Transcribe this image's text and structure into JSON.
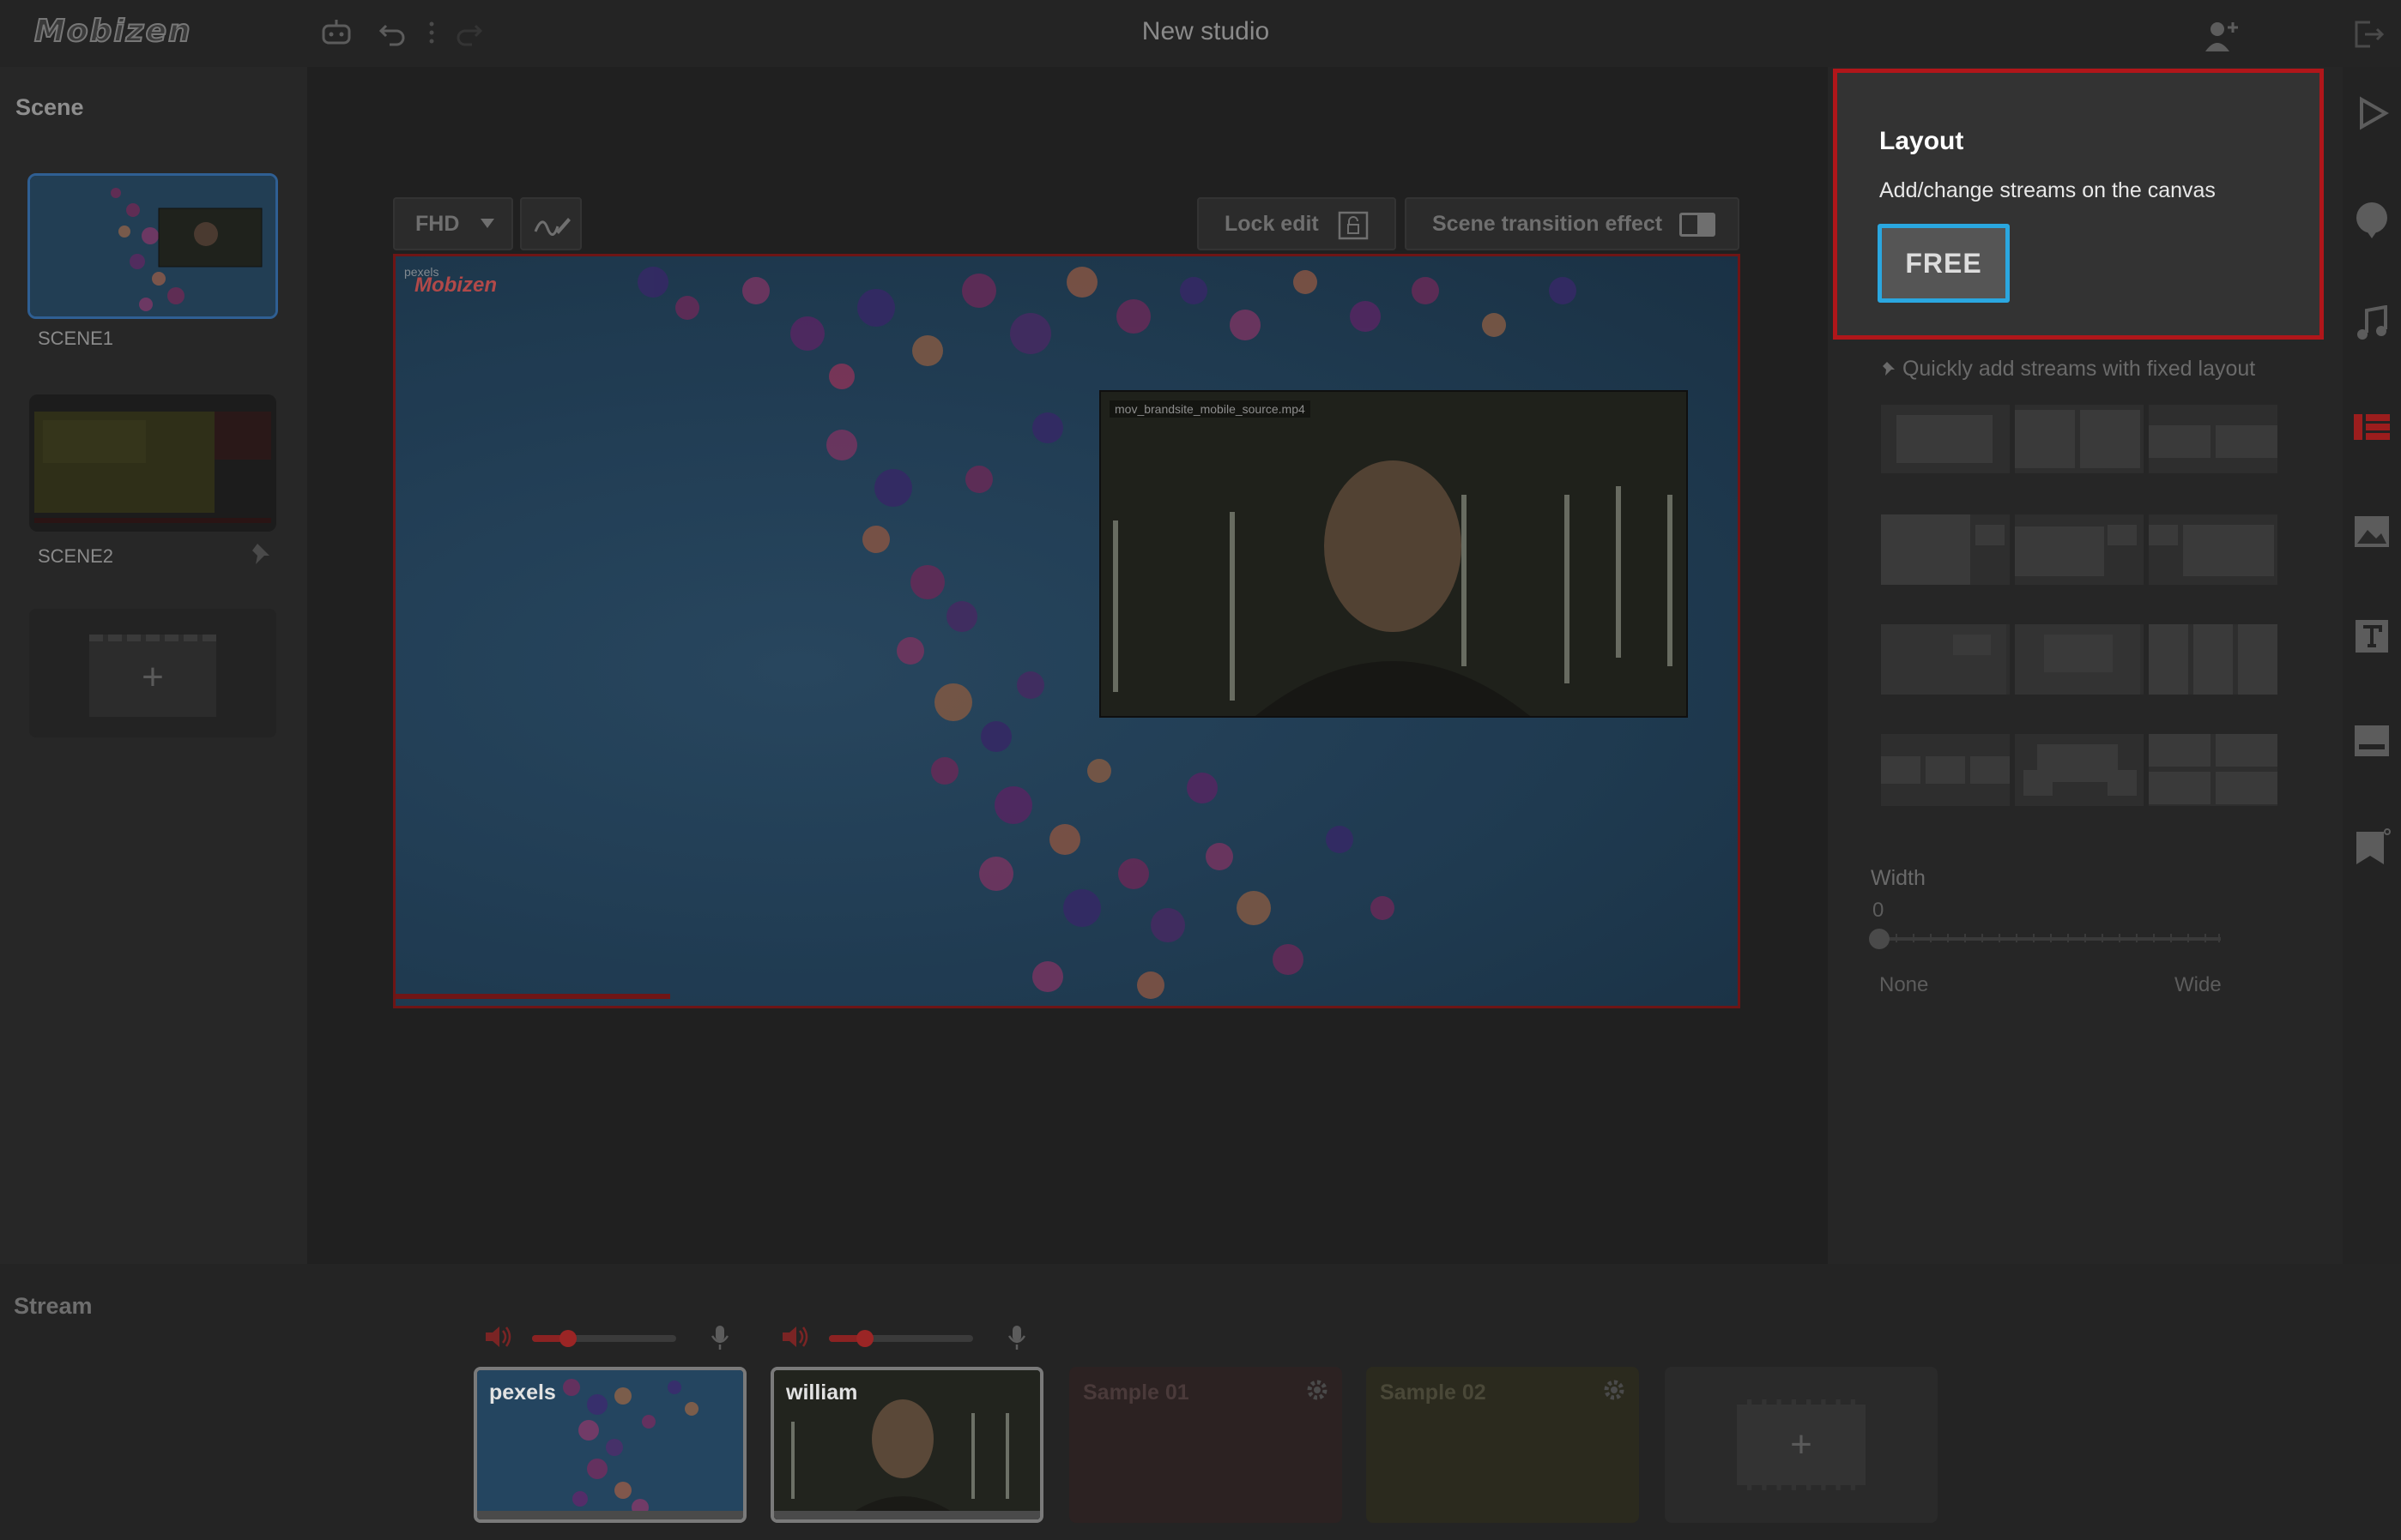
{
  "app": {
    "logo_text": "Mobizen",
    "studio_title": "New studio"
  },
  "scene_panel": {
    "title": "Scene",
    "scenes": [
      {
        "label": "SCENE1"
      },
      {
        "label": "SCENE2"
      }
    ],
    "add_symbol": "+"
  },
  "canvas_toolbar": {
    "resolution": "FHD",
    "lock_edit_label": "Lock edit",
    "scene_transition_label": "Scene transition effect"
  },
  "canvas": {
    "watermark_small": "pexels",
    "watermark_logo": "Mobizen",
    "pip_caption": "mov_brandsite_mobile_source.mp4"
  },
  "layout_panel": {
    "heading": "Layout",
    "subtitle": "Add/change streams on the canvas",
    "free_button": "FREE",
    "quick_tip": "Quickly add streams with fixed layout",
    "width_label": "Width",
    "width_value": "0",
    "width_min_label": "None",
    "width_max_label": "Wide"
  },
  "stream_panel": {
    "title": "Stream",
    "streams": [
      {
        "name": "pexels"
      },
      {
        "name": "william"
      },
      {
        "name": "Sample 01"
      },
      {
        "name": "Sample 02"
      }
    ],
    "add_symbol": "+"
  },
  "icons": {
    "top_left": [
      "robot-icon",
      "undo-icon",
      "more-icon",
      "redo-icon"
    ],
    "top_right": [
      "add-user-icon",
      "exit-icon"
    ],
    "rail": [
      "play-icon",
      "chat-icon",
      "music-icon",
      "layout-icon",
      "image-icon",
      "text-icon",
      "subtitle-icon",
      "bookmark-icon"
    ]
  },
  "colors": {
    "highlight_border": "#b0161a",
    "free_button_border": "#2aa7e0",
    "canvas_border": "#6e1515"
  }
}
